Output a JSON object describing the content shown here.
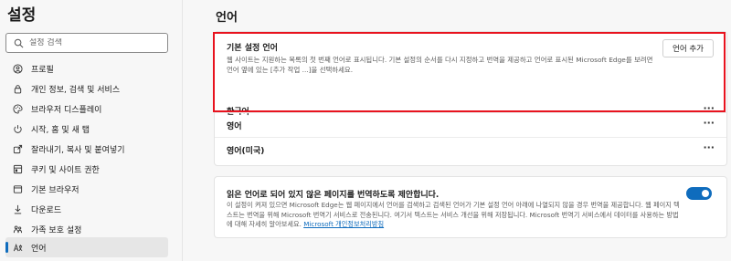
{
  "sidebar": {
    "title": "설정",
    "search": {
      "placeholder": "설정 검색",
      "icon": "search-icon"
    },
    "items": [
      {
        "label": "프로필",
        "icon": "person-icon",
        "active": false
      },
      {
        "label": "개인 정보, 검색 및 서비스",
        "icon": "lock-icon",
        "active": false
      },
      {
        "label": "브라우저 디스플레이",
        "icon": "palette-icon",
        "active": false
      },
      {
        "label": "시작, 홈 및 새 탭",
        "icon": "power-icon",
        "active": false
      },
      {
        "label": "잘라내기, 복사 및 붙여넣기",
        "icon": "share-icon",
        "active": false
      },
      {
        "label": "쿠키 및 사이트 권한",
        "icon": "cookie-icon",
        "active": false
      },
      {
        "label": "기본 브라우저",
        "icon": "browser-icon",
        "active": false
      },
      {
        "label": "다운로드",
        "icon": "download-icon",
        "active": false
      },
      {
        "label": "가족 보호 설정",
        "icon": "family-icon",
        "active": false
      },
      {
        "label": "언어",
        "icon": "language-icon",
        "active": true
      }
    ]
  },
  "main": {
    "title": "언어",
    "preferred": {
      "title": "기본 설정 언어",
      "description": "웹 사이트는 지원하는 목록의 첫 번째 언어로 표시됩니다. 기본 설정의 순서를 다시 지정하고 번역을 제공하고 언어로 표시된 Microsoft Edge를 보려면 언어 옆에 있는 [추가 작업 ...]을 선택하세요.",
      "add_button": "언어 추가",
      "languages": [
        {
          "label": "한국어",
          "more": "···"
        },
        {
          "label": "영어",
          "more": "···"
        },
        {
          "label": "영어(미국)",
          "more": "···"
        }
      ]
    },
    "translate": {
      "title": "읽은 언어로 되어 있지 않은 페이지를 번역하도록 제안합니다.",
      "description": "이 설정이 켜져 있으면 Microsoft Edge는 웹 페이지에서 언어를 검색하고 검색된 언어가 기본 설정 언어 아래에 나열되지 않을 경우 번역을 제공합니다. 웹 페이지 텍스트는 번역을 위해 Microsoft 번역기 서비스로 전송된니다. 여기서 텍스트는 서비스 개선을 위해 저장됩니다. Microsoft 번역기 서비스에서 데이터를 사용하는 방법에 대해 자세히 알아보세요.",
      "link": "Microsoft 개인정보처리방침",
      "toggle_on": true
    }
  },
  "colors": {
    "accent": "#0f6cbd",
    "highlight": "#e8131e"
  }
}
